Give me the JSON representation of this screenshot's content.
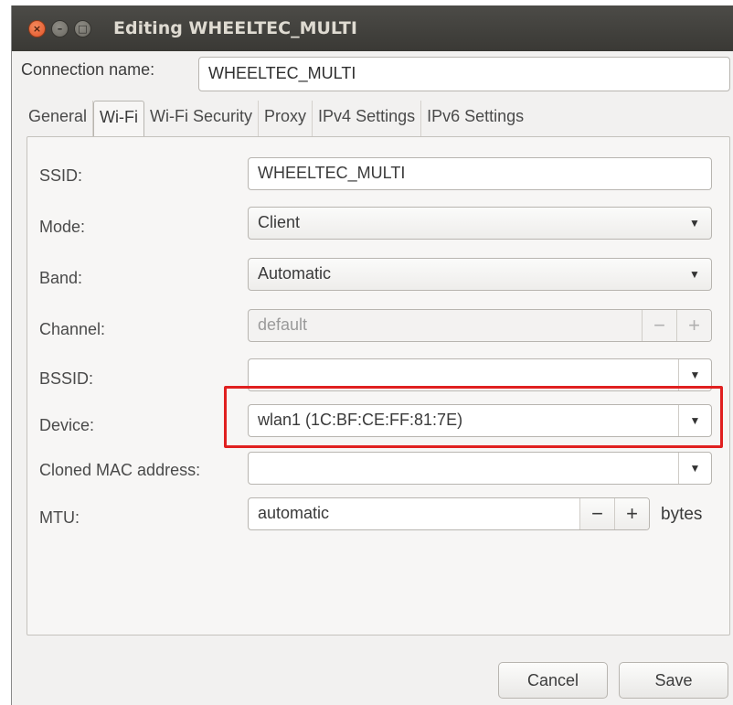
{
  "window": {
    "title": "Editing WHEELTEC_MULTI",
    "close_glyph": "×",
    "minimize_glyph": "–",
    "maximize_glyph": "□"
  },
  "connection": {
    "label": "Connection name:",
    "value": "WHEELTEC_MULTI"
  },
  "tabs": [
    {
      "label": "General"
    },
    {
      "label": "Wi-Fi",
      "active": true
    },
    {
      "label": "Wi-Fi Security"
    },
    {
      "label": "Proxy"
    },
    {
      "label": "IPv4 Settings"
    },
    {
      "label": "IPv6 Settings"
    }
  ],
  "wifi": {
    "ssid": {
      "label": "SSID:",
      "value": "WHEELTEC_MULTI"
    },
    "mode": {
      "label": "Mode:",
      "value": "Client"
    },
    "band": {
      "label": "Band:",
      "value": "Automatic"
    },
    "channel": {
      "label": "Channel:",
      "placeholder": "default",
      "minus": "−",
      "plus": "+"
    },
    "bssid": {
      "label": "BSSID:",
      "value": ""
    },
    "device": {
      "label": "Device:",
      "value": "wlan1 (1C:BF:CE:FF:81:7E)"
    },
    "cloned_mac": {
      "label": "Cloned MAC address:",
      "value": ""
    },
    "mtu": {
      "label": "MTU:",
      "value": "automatic",
      "minus": "−",
      "plus": "+",
      "unit": "bytes"
    }
  },
  "dropdown_glyph": "▼",
  "buttons": {
    "cancel": "Cancel",
    "save": "Save"
  },
  "colors": {
    "highlight": "#e02020",
    "titlebar": "#3f3e3a",
    "close_button": "#e0542a"
  }
}
